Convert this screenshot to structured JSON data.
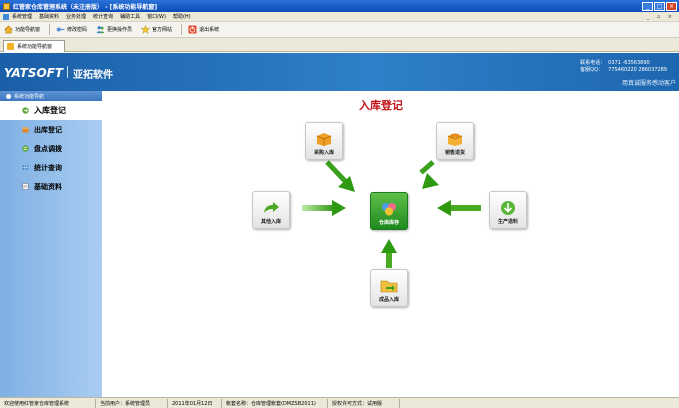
{
  "window": {
    "title": "红管家仓库管理系统（未注册版） - [系统功能导航窗]"
  },
  "menu": {
    "items": [
      "系统管理",
      "基础资料",
      "业务处理",
      "统计查询",
      "辅助工具",
      "窗口(W)",
      "帮助(H)"
    ],
    "mdi_controls": "_ ▫ ×"
  },
  "toolbar": {
    "items": [
      {
        "label": "功能导航窗",
        "icon": "home-icon"
      },
      {
        "label": "修改密码",
        "icon": "key-icon"
      },
      {
        "label": "更换操作员",
        "icon": "users-icon"
      },
      {
        "label": "官方网站",
        "icon": "star-icon"
      },
      {
        "label": "退出系统",
        "icon": "exit-icon"
      }
    ]
  },
  "tabs": [
    {
      "label": "系统功能导航窗"
    }
  ],
  "banner": {
    "logo": "YATSOFT",
    "company": "亚拓软件",
    "phone_label": "联系电话：",
    "phone": "0371 -63563890",
    "qq_label": "客服QQ：",
    "qq": "775460220  286037289",
    "slogan": "用真诚服务感动客户"
  },
  "sidebar": {
    "header": "系统功能导航",
    "items": [
      {
        "label": "入库登记",
        "active": true,
        "color": "#5aa832"
      },
      {
        "label": "出库登记",
        "active": false,
        "color": "#e0882a"
      },
      {
        "label": "盘点调拨",
        "active": false,
        "color": "#5aa832"
      },
      {
        "label": "统计查询",
        "active": false,
        "color": "#3a88d0"
      },
      {
        "label": "基础资料",
        "active": false,
        "color": "#888888"
      }
    ]
  },
  "main": {
    "title": "入库登记",
    "nodes": {
      "purchase": "采购入库",
      "sales_return": "销售退货",
      "other": "其他入库",
      "warehouse": "仓库库存",
      "production": "生产退料",
      "finished": "成品入库"
    }
  },
  "statusbar": {
    "welcome": "欢迎使用红管家仓库管理系统",
    "user": "当前用户：系统管理员",
    "date": "2011年01月12日",
    "account": "帐套名称：仓库管理帐套(DMZSB2011)",
    "license": "授权许可方式：试用版"
  },
  "colors": {
    "titlebar": "#0b4bb8",
    "banner": "#2f80c8",
    "sidebar": "#a9cdf1",
    "page_title": "#c3121a",
    "arrow": "#3aa01e"
  }
}
